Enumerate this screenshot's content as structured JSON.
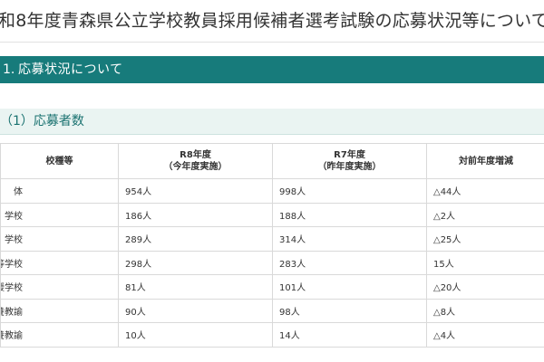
{
  "page": {
    "title": "和8年度青森県公立学校教員採用候補者選考試験の応募状況等について"
  },
  "section": {
    "number": "1.",
    "label": "応募状況について"
  },
  "subsection": {
    "label": "（1）応募者数"
  },
  "table": {
    "headers": {
      "type": "校種等",
      "r8_line1": "R8年度",
      "r8_line2": "（今年度実施）",
      "r7_line1": "R7年度",
      "r7_line2": "（昨年度実施）",
      "diff": "対前年度増減"
    },
    "rows": [
      {
        "type": "体",
        "r8": "954人",
        "r7": "998人",
        "diff": "△44人"
      },
      {
        "type": "学校",
        "r8": "186人",
        "r7": "188人",
        "diff": "△2人"
      },
      {
        "type": "学校",
        "r8": "289人",
        "r7": "314人",
        "diff": "△25人"
      },
      {
        "type": "等学校",
        "r8": "298人",
        "r7": "283人",
        "diff": "15人"
      },
      {
        "type": "別支援学校",
        "r8": "81人",
        "r7": "101人",
        "diff": "△20人"
      },
      {
        "type": "養教諭",
        "r8": "90人",
        "r7": "98人",
        "diff": "△8人"
      },
      {
        "type": "養教諭",
        "r8": "10人",
        "r7": "14人",
        "diff": "△4人"
      }
    ]
  }
}
